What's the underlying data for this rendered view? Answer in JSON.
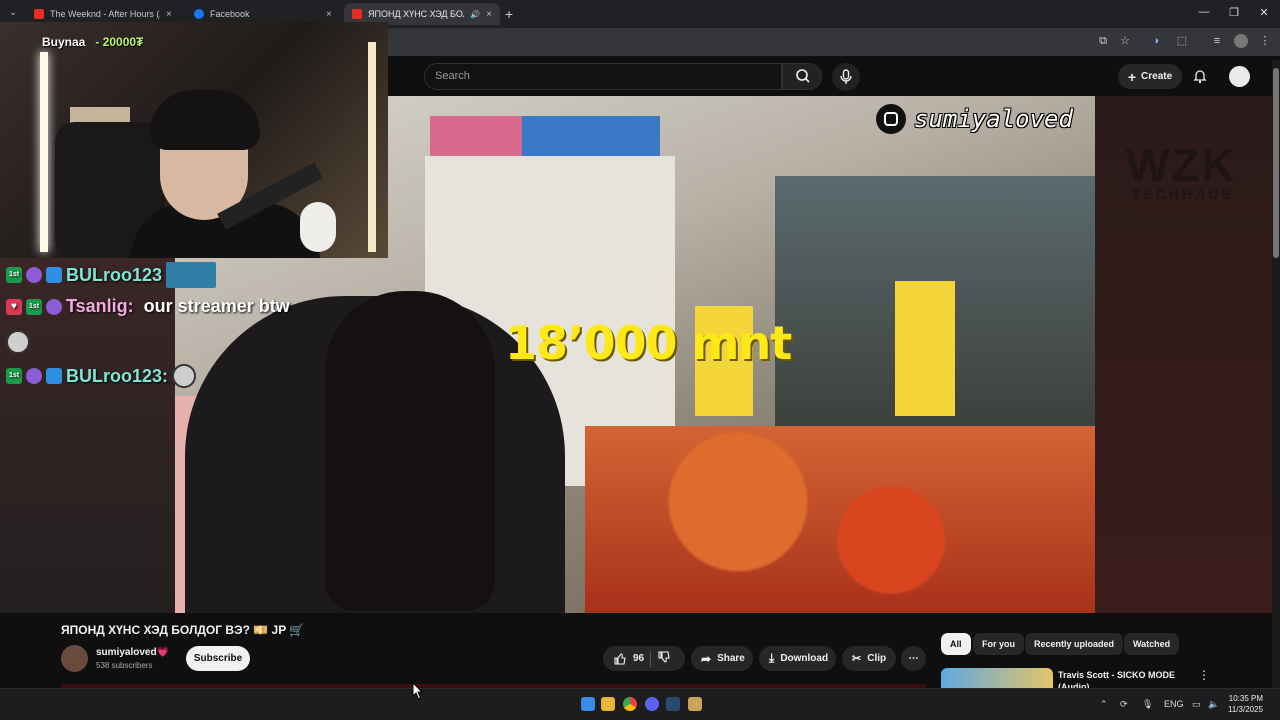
{
  "browser": {
    "tabs": [
      {
        "title": "The Weeknd - After Hours (Aud",
        "favicon_color": "#e52d27"
      },
      {
        "title": "Facebook",
        "favicon_color": "#1877f2"
      },
      {
        "title": "ЯПОНД ХҮНС ХЭД БОЛДО",
        "favicon_color": "#e52d27"
      }
    ],
    "new_tab": "+",
    "close_glyph": "×",
    "window_controls": {
      "minimize": "—",
      "maximize": "❐",
      "close": "✕"
    }
  },
  "youtube": {
    "search_placeholder": "Search",
    "create_label": "Create",
    "video": {
      "overlay_text": "18’000 mnt",
      "instagram_handle": "sumiyaloved",
      "watermark_main": "WZK",
      "watermark_sub": "TECHHAUS"
    },
    "title": "ЯПОНД ХҮНС ХЭД БОЛДОГ ВЭ? 💴 JP 🛒",
    "channel": {
      "name": "sumiyaloved💗",
      "subscribers": "538 subscribers"
    },
    "subscribe_label": "Subscribe",
    "like_count": "96",
    "share_label": "Share",
    "download_label": "Download",
    "clip_label": "Clip",
    "chips": [
      "All",
      "For you",
      "Recently uploaded",
      "Watched"
    ],
    "recommendation": {
      "title": "Travis Scott - SICKO MODE (Audio)"
    }
  },
  "stream": {
    "donation": {
      "user": "Buynaa",
      "amount": "- 20000₮"
    },
    "chat": [
      {
        "user": "BULroo123",
        "message": "",
        "color": "#7fe6d6"
      },
      {
        "user": "Tsanlig:",
        "message": "our streamer btw",
        "color": "#f3a8e0"
      },
      {
        "user": "",
        "message": "",
        "color": "#ffffff"
      },
      {
        "user": "BULroo123:",
        "message": "",
        "color": "#7fe6d6"
      }
    ],
    "badges": {
      "first": "1st"
    }
  },
  "taskbar": {
    "tray_lang": "ENG",
    "time": "10:35 PM",
    "date": "11/3/2025"
  }
}
